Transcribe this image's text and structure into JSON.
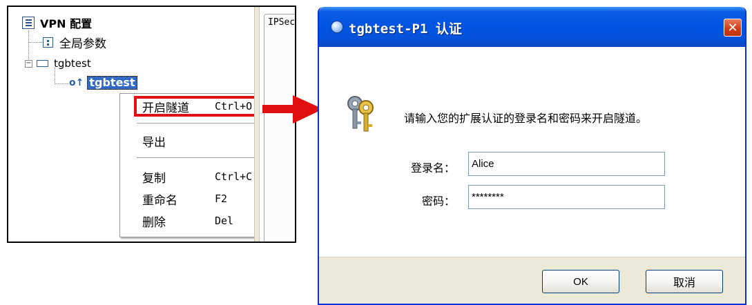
{
  "tree": {
    "root_label": "VPN 配置",
    "global_params_label": "全局参数",
    "gateway_label": "tgbtest",
    "gateway_expander": "−",
    "tunnel_label": "tgbtest",
    "tunnel_icon_glyph": "o↑",
    "tab_label": "IPSec"
  },
  "context_menu": {
    "items": [
      {
        "label": "开启隧道",
        "shortcut": "Ctrl+O",
        "highlighted": true
      },
      {
        "label": "导出",
        "shortcut": ""
      },
      {
        "label": "复制",
        "shortcut": "Ctrl+C"
      },
      {
        "label": "重命名",
        "shortcut": "F2"
      },
      {
        "label": "删除",
        "shortcut": "Del"
      }
    ]
  },
  "dialog": {
    "title": "tgbtest-P1 认证",
    "close_glyph": "✕",
    "message": "请输入您的扩展认证的登录名和密码来开启隧道。",
    "username_label": "登录名：",
    "username_value": "Alice",
    "password_label": "密码：",
    "password_value": "********",
    "ok_label": "OK",
    "cancel_label": "取消"
  },
  "colors": {
    "highlight_border": "#e01010",
    "selection_bg": "#316ac5",
    "titlebar_blue": "#0054e3",
    "close_red": "#cf3b12"
  },
  "icons": {
    "root": "list-icon",
    "global": "settings-box-icon",
    "gateway": "gateway-rect-icon",
    "tunnel": "tunnel-icon",
    "dialog": "keys-icon",
    "arrow": "red-arrow-icon"
  }
}
